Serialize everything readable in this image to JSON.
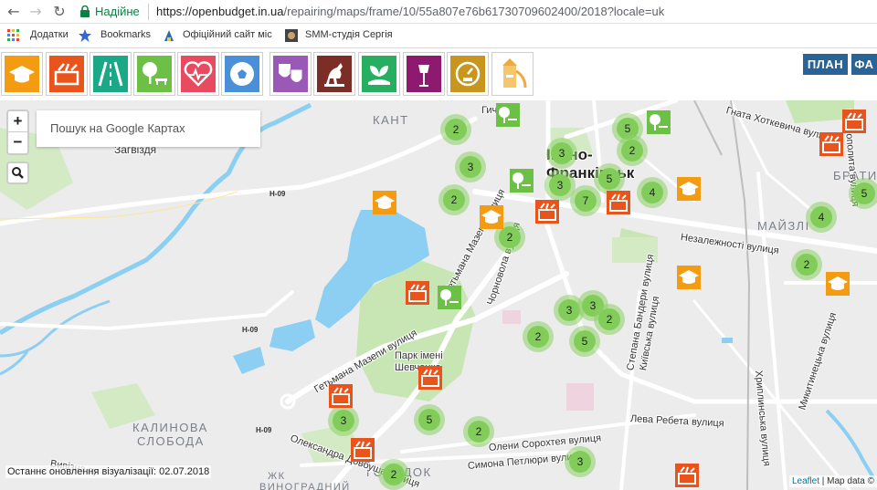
{
  "browser": {
    "back_icon": "←",
    "forward_icon": "→",
    "reload_icon": "↻",
    "secure_label": "Надійне",
    "url_host": "https://openbudget.in.ua",
    "url_path": "/repairing/maps/frame/10/55a807e76b61730709602400/2018?locale=uk"
  },
  "bookmarks": [
    {
      "icon": "apps-grid-icon",
      "label": "Додатки"
    },
    {
      "icon": "star-icon",
      "label": "Bookmarks"
    },
    {
      "icon": "official-site-icon",
      "label": "Офіційний сайт міс"
    },
    {
      "icon": "smm-icon",
      "label": "SMM-студія Сергія"
    }
  ],
  "categories": [
    {
      "icon": "education-icon",
      "color": "#f39c12"
    },
    {
      "icon": "repair-icon",
      "color": "#e8541c"
    },
    {
      "icon": "road-icon",
      "color": "#1aa886"
    },
    {
      "icon": "park-icon",
      "color": "#6cc045"
    },
    {
      "icon": "health-icon",
      "color": "#e84a5f"
    },
    {
      "icon": "sport-icon",
      "color": "#4a90d9"
    },
    {
      "icon": "culture-icon",
      "color": "#9b59b6"
    },
    {
      "icon": "monument-icon",
      "color": "#7b2d26"
    },
    {
      "icon": "ecology-icon",
      "color": "#27ae60"
    },
    {
      "icon": "lighting-icon",
      "color": "#8e1a70"
    },
    {
      "icon": "meter-icon",
      "color": "#c8951f"
    },
    {
      "icon": "playground-icon",
      "color": "#f2a93b"
    }
  ],
  "top_buttons": {
    "plan": "ПЛАН",
    "fa": "ФА"
  },
  "map": {
    "search_placeholder": "Пошук на Google Картах",
    "zoom_in": "+",
    "zoom_out": "−",
    "search_icon": "search-icon",
    "city": "Івано-Франківськ",
    "city_line1": "Івано-",
    "city_line2": "Франківськ",
    "districts": [
      "КАНТ",
      "БРАТИ",
      "МАЙЗЛІ",
      "КАЛИНОВА",
      "СЛОБОДА",
      "ГОРОДОК",
      "ЖК",
      "ВИНОГРАДНИЙ"
    ],
    "labels": {
      "zagvizdia": "Загвіздя",
      "gicha": "Гича",
      "hotkevycha": "Гната Хоткевича вулиця",
      "nezalezhnosti": "Незалежності вулиця",
      "hetmana_mazepy_1": "Гетьмана Мазепи вулиця",
      "hetmana_mazepy_2": "Гетьмана Мазепи вулиця",
      "chornovola": "Чорновола вулиця",
      "bandery": "Степана Бандери вулиця",
      "kyivska": "Київська вулиця",
      "khryplyna": "Хриплинська вулиця",
      "mytropolyta": "Митрополита вулиця",
      "mykytynetska": "Микитинецька вулиця",
      "park_1": "Парк імені",
      "park_2": "Шевченка",
      "sorokhtei": "Олени Сорохтея вулиця",
      "petliury": "Симона Петлюри вулиця",
      "levy_rebeta": "Лева Ребета вулиця",
      "dovbusha": "Олександра Довбуша вулиця",
      "vyvizna": "Вивізна ву",
      "h09_a": "H-09",
      "h09_b": "H-09",
      "h09_c": "H-09"
    },
    "clusters": [
      "2",
      "5",
      "3",
      "3",
      "2",
      "2",
      "4",
      "3",
      "7",
      "5",
      "2",
      "4",
      "5",
      "2",
      "3",
      "3",
      "2",
      "2",
      "5",
      "3",
      "5",
      "2",
      "3",
      "2"
    ],
    "last_update": "Останнє оновлення візуалізації: 02.07.2018",
    "attribution_link": "Leaflet",
    "attribution_rest": " | Map data ©"
  }
}
